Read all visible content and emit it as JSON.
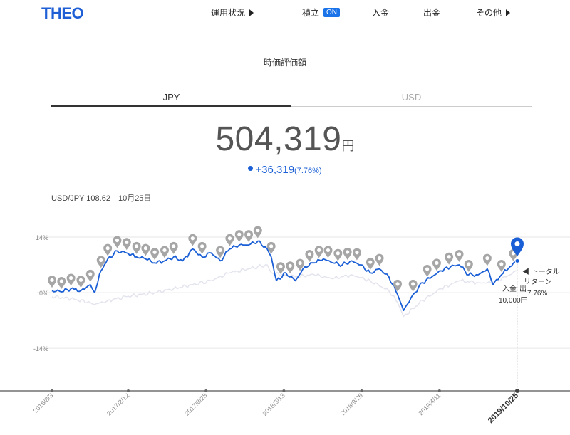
{
  "header": {
    "logo": "THEO",
    "nav": [
      {
        "label": "運用状況",
        "caret": true
      },
      {
        "label": "積立",
        "badge": "ON"
      },
      {
        "label": "入金"
      },
      {
        "label": "出金"
      },
      {
        "label": "その他",
        "caret": true
      }
    ]
  },
  "section_title": "時価評価額",
  "tabs": {
    "jpy": "JPY",
    "usd": "USD",
    "active": "JPY"
  },
  "total": {
    "value": "504,319",
    "unit": "円"
  },
  "gain": {
    "amount": "+36,319",
    "percent": "(7.76%)"
  },
  "fx_line": "USD/JPY 108.62　10月25日",
  "colors": {
    "accent": "#1a5fd6",
    "benchmark": "#e4e4ee",
    "pin": "#a6a6a6"
  },
  "tooltip": {
    "lines": [
      "◀ トータル",
      "リターン",
      "7.76%"
    ],
    "deposit_label": "入金",
    "deposit_short": "出",
    "deposit_amount": "10,000円"
  },
  "chart_data": {
    "type": "line",
    "x_ticks": [
      "2016/8/3",
      "2017/2/12",
      "2017/8/28",
      "2018/3/13",
      "2018/9/26",
      "2019/4/11",
      "2019/10/25"
    ],
    "x_tick_current": "2019/10/25",
    "y_ticks": [
      {
        "value": 14,
        "label": "14%"
      },
      {
        "value": 0,
        "label": "0%"
      },
      {
        "value": -14,
        "label": "-14%"
      }
    ],
    "ylim": [
      -22,
      15
    ],
    "grid": true,
    "series": [
      {
        "role": "total-return",
        "color": "#1a5fd6",
        "x": [
          "2016/8/3",
          "2016/8/27",
          "2016/9/20",
          "2016/10/15",
          "2016/11/8",
          "2016/11/19",
          "2016/12/5",
          "2016/12/22",
          "2017/1/15",
          "2017/2/8",
          "2017/3/5",
          "2017/3/28",
          "2017/4/20",
          "2017/5/15",
          "2017/6/7",
          "2017/6/30",
          "2017/7/25",
          "2017/8/18",
          "2017/9/10",
          "2017/10/3",
          "2017/10/27",
          "2017/11/20",
          "2017/12/14",
          "2018/1/6",
          "2018/1/30",
          "2018/2/9",
          "2018/2/22",
          "2018/3/18",
          "2018/4/11",
          "2018/5/5",
          "2018/5/29",
          "2018/6/21",
          "2018/7/15",
          "2018/8/8",
          "2018/9/1",
          "2018/9/24",
          "2018/10/18",
          "2018/11/10",
          "2018/12/4",
          "2018/12/26",
          "2019/1/10",
          "2019/2/3",
          "2019/2/27",
          "2019/3/23",
          "2019/4/15",
          "2019/5/9",
          "2019/5/31",
          "2019/6/24",
          "2019/7/18",
          "2019/8/10",
          "2019/8/25",
          "2019/9/15",
          "2019/10/6",
          "2019/10/25"
        ],
        "y": [
          0.5,
          0.2,
          1.0,
          0.5,
          2.0,
          0.0,
          5.5,
          8.5,
          10.5,
          10.0,
          9.0,
          8.5,
          7.5,
          8.0,
          9.0,
          8.0,
          11.0,
          9.0,
          10.0,
          8.0,
          11.0,
          12.0,
          12.0,
          13.0,
          11.0,
          9.0,
          3.0,
          5.0,
          3.0,
          6.5,
          7.5,
          8.5,
          7.5,
          7.0,
          8.0,
          7.0,
          5.0,
          6.0,
          4.0,
          -0.5,
          -4.5,
          -0.5,
          2.5,
          4.0,
          5.5,
          6.5,
          7.0,
          4.5,
          4.5,
          6.0,
          2.0,
          4.5,
          6.5,
          8.0
        ]
      },
      {
        "role": "benchmark",
        "color": "#e4e4ee",
        "x": [
          "2016/8/3",
          "2016/9/20",
          "2016/11/8",
          "2016/11/19",
          "2016/12/22",
          "2017/2/8",
          "2017/4/20",
          "2017/6/7",
          "2017/7/25",
          "2017/9/10",
          "2017/10/27",
          "2017/12/14",
          "2018/1/30",
          "2018/2/9",
          "2018/4/11",
          "2018/5/29",
          "2018/7/15",
          "2018/9/1",
          "2018/10/18",
          "2018/12/4",
          "2018/12/26",
          "2019/1/10",
          "2019/2/27",
          "2019/4/15",
          "2019/5/31",
          "2019/7/18",
          "2019/8/25",
          "2019/10/6",
          "2019/10/25"
        ],
        "y": [
          -1.0,
          -1.5,
          -2.5,
          -3.0,
          -2.0,
          -1.0,
          0.0,
          1.0,
          2.0,
          3.0,
          5.0,
          6.0,
          7.0,
          5.0,
          4.0,
          4.5,
          3.5,
          4.5,
          3.0,
          0.5,
          -2.5,
          -6.0,
          -2.0,
          1.0,
          3.0,
          2.5,
          2.5,
          4.5,
          5.5
        ]
      }
    ],
    "events": [
      "2016/8/3",
      "2016/8/27",
      "2016/9/20",
      "2016/10/15",
      "2016/11/8",
      "2016/12/5",
      "2016/12/22",
      "2017/1/15",
      "2017/2/8",
      "2017/3/5",
      "2017/3/28",
      "2017/4/20",
      "2017/5/15",
      "2017/6/7",
      "2017/7/25",
      "2017/8/18",
      "2017/10/3",
      "2017/10/27",
      "2017/11/20",
      "2017/12/14",
      "2018/1/6",
      "2018/2/9",
      "2018/3/5",
      "2018/3/29",
      "2018/4/23",
      "2018/5/17",
      "2018/6/10",
      "2018/7/3",
      "2018/7/28",
      "2018/8/21",
      "2018/9/14",
      "2018/10/18",
      "2018/11/10",
      "2018/12/26",
      "2019/2/3",
      "2019/3/11",
      "2019/4/4",
      "2019/5/5",
      "2019/5/31",
      "2019/6/24",
      "2019/8/10",
      "2019/9/15",
      "2019/10/15"
    ],
    "current_marker": "2019/10/25"
  }
}
